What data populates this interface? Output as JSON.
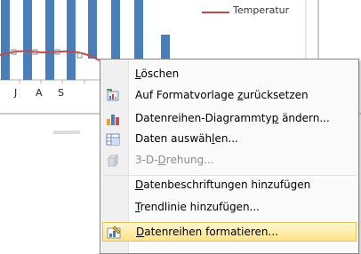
{
  "chart": {
    "legend_label": "Temperatur",
    "x_ticks": [
      "J",
      "A",
      "S"
    ],
    "series_color": "#4a7ebb",
    "line_color": "#be4b48"
  },
  "menu": {
    "items": [
      {
        "label_pre": "",
        "label_ul": "L",
        "label_post": "öschen",
        "icon": "none",
        "disabled": false
      },
      {
        "label_pre": "Auf Formatvorlage ",
        "label_ul": "z",
        "label_post": "urücksetzen",
        "icon": "reset-style-icon",
        "disabled": false
      },
      {
        "label_pre": "Datenreihen-Diagrammty",
        "label_ul": "p",
        "label_post": " ändern...",
        "icon": "chart-type-icon",
        "disabled": false
      },
      {
        "label_pre": "Daten auswäh",
        "label_ul": "l",
        "label_post": "en...",
        "icon": "select-data-icon",
        "disabled": false
      },
      {
        "label_pre": "3-D-",
        "label_ul": "D",
        "label_post": "rehung...",
        "icon": "3d-rotation-icon",
        "disabled": true
      },
      {
        "label_pre": "",
        "label_ul": "D",
        "label_post": "atenbeschriftungen hinzufügen",
        "icon": "none",
        "disabled": false
      },
      {
        "label_pre": "",
        "label_ul": "T",
        "label_post": "rendlinie hinzufügen...",
        "icon": "none",
        "disabled": false
      },
      {
        "label_pre": "",
        "label_ul": "D",
        "label_post": "atenreihen formatieren...",
        "icon": "format-series-icon",
        "disabled": false
      }
    ]
  }
}
